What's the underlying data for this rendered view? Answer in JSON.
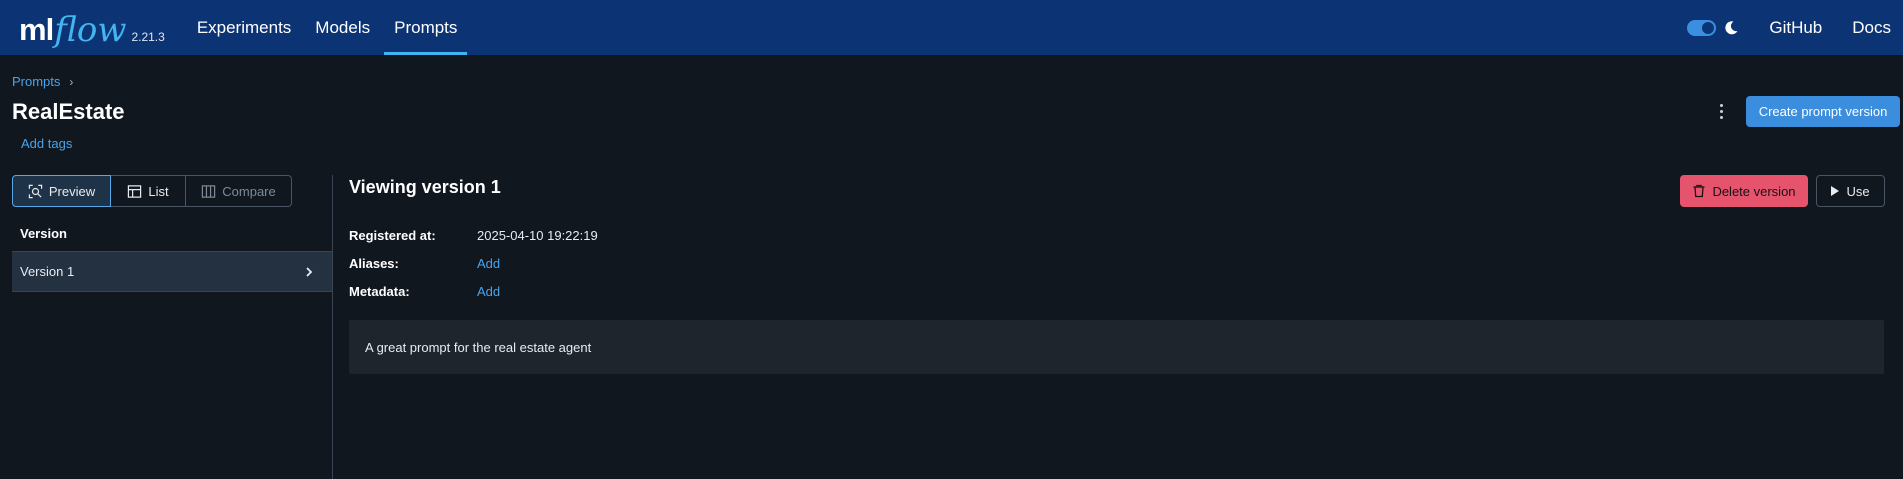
{
  "nav": {
    "logo_ml": "ml",
    "logo_flow": "flow",
    "version": "2.21.3",
    "links": [
      {
        "label": "Experiments",
        "active": false
      },
      {
        "label": "Models",
        "active": false
      },
      {
        "label": "Prompts",
        "active": true
      }
    ],
    "github": "GitHub",
    "docs": "Docs",
    "dark_mode_on": true
  },
  "header": {
    "breadcrumb": "Prompts",
    "breadcrumb_sep": "›",
    "title": "RealEstate",
    "add_tags": "Add tags",
    "create_button": "Create prompt version"
  },
  "view_modes": {
    "preview": "Preview",
    "list": "List",
    "compare": "Compare"
  },
  "versions": {
    "header": "Version",
    "items": [
      {
        "label": "Version 1"
      }
    ]
  },
  "detail": {
    "title": "Viewing version 1",
    "delete_button": "Delete version",
    "use_button": "Use",
    "registered_label": "Registered at:",
    "registered_value": "2025-04-10 19:22:19",
    "aliases_label": "Aliases:",
    "aliases_action": "Add",
    "metadata_label": "Metadata:",
    "metadata_action": "Add",
    "prompt_text": "A great prompt for the real estate agent"
  },
  "colors": {
    "nav_bg": "#0c3474",
    "page_bg": "#11171f",
    "accent": "#43b4f0",
    "primary": "#3b8ddd",
    "danger": "#e5536d",
    "link": "#4aa3ea"
  },
  "icons": [
    "toggle-switch",
    "moon-icon",
    "preview-icon",
    "table-icon",
    "columns-icon",
    "chevron-right-icon",
    "trash-icon",
    "play-icon",
    "kebab-menu-icon"
  ]
}
